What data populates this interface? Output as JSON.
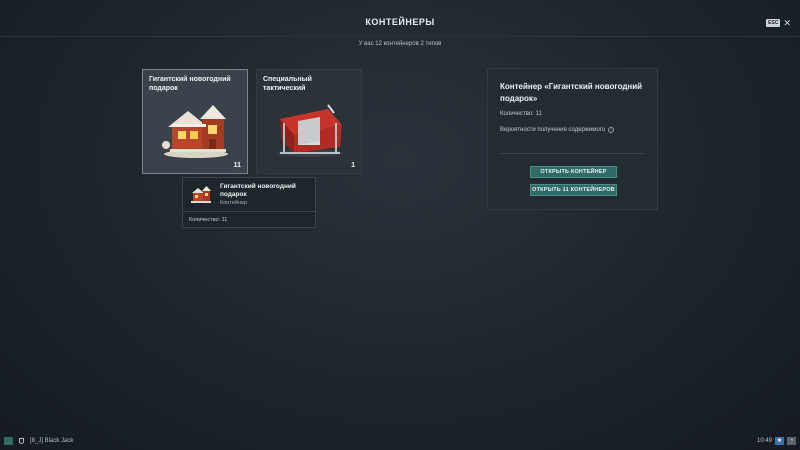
{
  "header": {
    "title": "КОНТЕЙНЕРЫ",
    "esc_key": "ESC",
    "close_glyph": "✕",
    "subtitle": "У вас 12 контейнеров 2 типов"
  },
  "containers": [
    {
      "name": "Гигантский новогодний подарок",
      "count": "11",
      "icon": "gingerbread-house-icon",
      "selected": true
    },
    {
      "name": "Специальный тактический",
      "count": "1",
      "icon": "tactical-crate-icon",
      "selected": false
    }
  ],
  "tooltip": {
    "name": "Гигантский новогодний подарок",
    "type": "Контейнер",
    "quantity": "Количество: 11"
  },
  "detail": {
    "title": "Контейнер «Гигантский новогодний подарок»",
    "quantity": "Количество: 11",
    "probabilities": "Вероятности получения содержимого",
    "open_one": "ОТКРЫТЬ КОНТЕЙНЕР",
    "open_all": "ОТКРЫТЬ 11 КОНТЕЙНЕРОВ"
  },
  "footer": {
    "player": "[8_J] Black Jack",
    "time": "10:49"
  },
  "colors": {
    "accent": "#2f6a66",
    "background": "#1d252c",
    "selected_card": "#3a434b"
  }
}
